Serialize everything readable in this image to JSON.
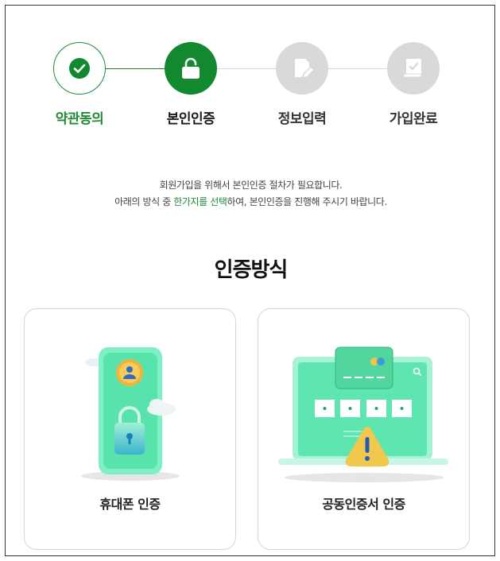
{
  "steps": [
    {
      "label": "약관동의",
      "status": "completed",
      "icon": "check-icon"
    },
    {
      "label": "본인인증",
      "status": "active",
      "icon": "unlock-icon"
    },
    {
      "label": "정보입력",
      "status": "pending",
      "icon": "edit-document-icon"
    },
    {
      "label": "가입완료",
      "status": "pending",
      "icon": "clipboard-check-icon"
    }
  ],
  "intro": {
    "line1": "회원가입을 위해서 본인인증 절차가 필요합니다.",
    "line2_prefix": "아래의 방식 중 ",
    "line2_highlight": "한가지를 선택",
    "line2_suffix": "하여, 본인인증을 진행해 주시기 바랍니다."
  },
  "section_title": "인증방식",
  "methods": [
    {
      "label": "휴대폰 인증",
      "icon": "phone-lock-icon"
    },
    {
      "label": "공동인증서 인증",
      "icon": "certificate-laptop-icon"
    }
  ],
  "colors": {
    "brand_green": "#12882f",
    "completed_green": "#1f8a36",
    "pending_gray": "#d9d9d9",
    "mint": "#5fe6b0"
  }
}
